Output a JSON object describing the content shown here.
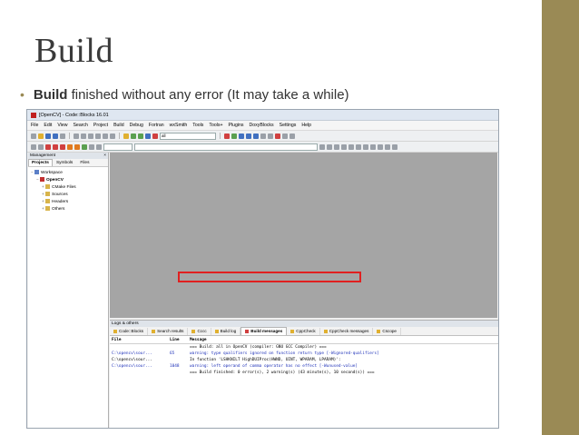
{
  "slide": {
    "title": "Build",
    "bullet_bold": "Build",
    "bullet_rest": " finished without any error (It may take a while)"
  },
  "window": {
    "title": "[OpenCV] - Code::Blocks 16.01",
    "menu": [
      "File",
      "Edit",
      "View",
      "Search",
      "Project",
      "Build",
      "Debug",
      "Fortran",
      "wxSmith",
      "Tools",
      "Tools+",
      "Plugins",
      "DoxyBlocks",
      "Settings",
      "Help"
    ],
    "build_target": "all"
  },
  "management": {
    "header": "Management",
    "tabs": [
      "Projects",
      "Symbols",
      "Files"
    ],
    "active_tab": "Projects",
    "tree": {
      "workspace": "Workspace",
      "project": "OpenCV",
      "folders": [
        "CMake Files",
        "Sources",
        "Headers",
        "Others"
      ]
    }
  },
  "logs": {
    "header": "Logs & others",
    "tabs": [
      "Code::Blocks",
      "Search results",
      "Cccc",
      "Build log",
      "Build messages",
      "CppCheck",
      "CppCheck messages",
      "Cscope"
    ],
    "active_tab": "Build messages",
    "columns": [
      "File",
      "Line",
      "Message"
    ],
    "rows": [
      {
        "file": "",
        "line": "",
        "message": "=== Build: all in OpenCV (compiler: GNU GCC Compiler) ===",
        "style": "normal"
      },
      {
        "file": "C:\\opencv\\sour...",
        "line": "65",
        "message": "warning: type qualifiers ignored on function return type [-Wignored-qualifiers]",
        "style": "blue"
      },
      {
        "file": "C:\\opencv\\sour...",
        "line": "",
        "message": "In function 'LSHKNILT HighDUIProc(HWND, UINT, WPARAM, LPARAM)':",
        "style": "normal"
      },
      {
        "file": "C:\\opencv\\sour...",
        "line": "1048",
        "message": "warning: left operand of comma operator has no effect [-Wunused-value]",
        "style": "blue"
      },
      {
        "file": "",
        "line": "",
        "message": "=== Build finished: 0 error(s), 2 warning(s) (43 minute(s), 10 second(s)) ===",
        "style": "normal"
      }
    ]
  },
  "colors": {
    "accent_stripe": "#9a8a55",
    "highlight_box": "#e02020",
    "warning_text": "#1c2fb8"
  }
}
